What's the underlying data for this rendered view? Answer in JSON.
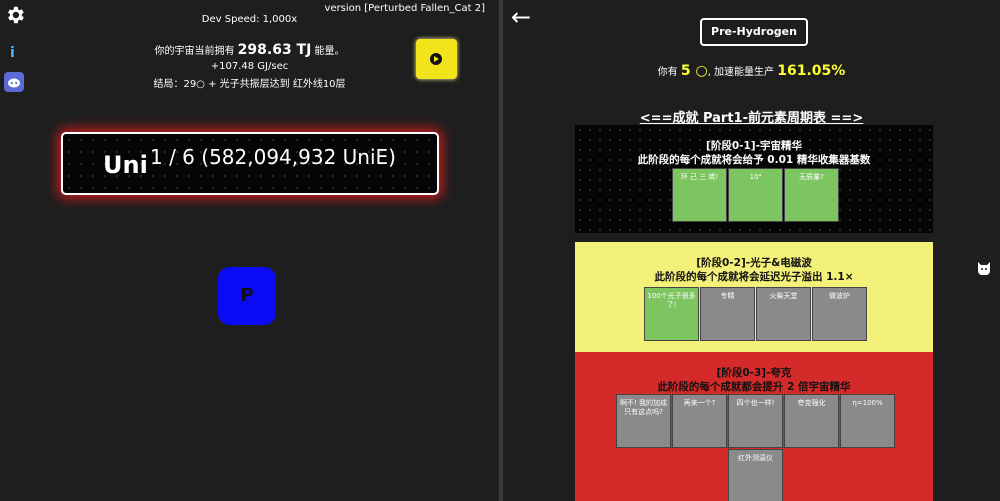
{
  "left": {
    "version": "version [Perturbed Fallen_Cat 2]",
    "dev_speed": "Dev Speed: 1,000x",
    "energy_prefix": "你的宇宙当前拥有",
    "energy_value": "298.63 TJ",
    "energy_suffix": "能量。",
    "energy_rate": "+107.48 GJ/sec",
    "goal": "结局：29○ + 光子共振层达到 红外线10层",
    "uni_label": "Uni",
    "uni_count": "1 / 6 (582,094,932 UniE)",
    "p_button": "P",
    "icons": {
      "settings": "gear-icon",
      "info": "info-icon",
      "discord": "discord-icon",
      "video": "play-icon"
    }
  },
  "right": {
    "back": "←",
    "era_button": "Pre-Hydrogen",
    "have_prefix": "你有",
    "have_value": "5 ○",
    "have_mid": ", 加速能量生产",
    "have_percent": "161.05%",
    "section_title": "<==成就 Part1-前元素周期表 ==>",
    "stages": [
      {
        "title": "[阶段0-1]-宇宙精华",
        "desc": "此阶段的每个成就将会给予 0.01 精华收集器基数",
        "achievements": [
          {
            "label": "环 己 三 烯!",
            "done": true
          },
          {
            "label": "10⁴",
            "done": true
          },
          {
            "label": "无质量?",
            "done": true
          }
        ]
      },
      {
        "title": "[阶段0-2]-光子&电磁波",
        "desc": "此阶段的每个成就将会延迟光子溢出 1.1×",
        "achievements": [
          {
            "label": "100个光子很多了!",
            "done": true
          },
          {
            "label": "专精",
            "done": false
          },
          {
            "label": "火柴天堂",
            "done": false
          },
          {
            "label": "微波炉",
            "done": false
          }
        ]
      },
      {
        "title": "[阶段0-3]-夸克",
        "desc": "此阶段的每个成就都会提升 2 倍宇宙精华",
        "achievements": [
          {
            "label": "啊不! 我的加成只有这点吗?",
            "done": false
          },
          {
            "label": "再来一个?",
            "done": false
          },
          {
            "label": "四个也一样!",
            "done": false
          },
          {
            "label": "夸克强化",
            "done": false
          },
          {
            "label": "η=100%",
            "done": false
          },
          {
            "label": "红外测温仪",
            "done": false
          }
        ]
      }
    ],
    "side_icon": "cat-icon"
  },
  "colors": {
    "accent_yellow": "#ffff33",
    "done": "#7cc560",
    "todo": "#8a8a8a",
    "stage2_bg": "#f4f17a",
    "stage3_bg": "#d42a2a",
    "glow": "#d21c1c",
    "p_button": "#0a0af5"
  }
}
